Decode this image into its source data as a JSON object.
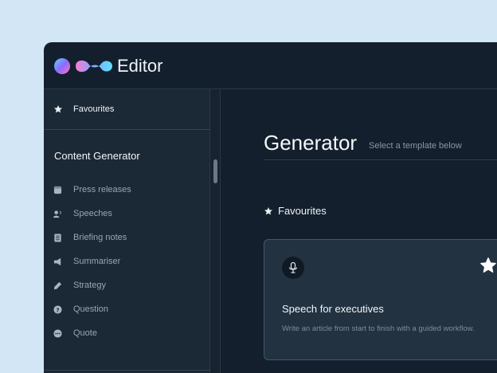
{
  "app": {
    "name": "Editor"
  },
  "sidebar": {
    "favourites_label": "Favourites",
    "section_title": "Content Generator",
    "items": [
      {
        "label": "Press releases",
        "icon": "document-icon"
      },
      {
        "label": "Speeches",
        "icon": "speaker-icon"
      },
      {
        "label": "Briefing notes",
        "icon": "notebook-icon"
      },
      {
        "label": "Summariser",
        "icon": "megaphone-icon"
      },
      {
        "label": "Strategy",
        "icon": "pen-icon"
      },
      {
        "label": "Question",
        "icon": "question-icon"
      },
      {
        "label": "Quote",
        "icon": "quote-bubble-icon"
      }
    ]
  },
  "main": {
    "title": "Generator",
    "subtitle": "Select a template below",
    "favourites_heading": "Favourites",
    "card": {
      "title": "Speech for executives",
      "description": "Write an article from start to finish with a guided workflow.",
      "icon": "microphone-icon",
      "favourite": true
    }
  },
  "colors": {
    "background": "#d3e6f5",
    "window": "#131f2c",
    "sidebar": "#1b2835",
    "card": "#223241"
  }
}
